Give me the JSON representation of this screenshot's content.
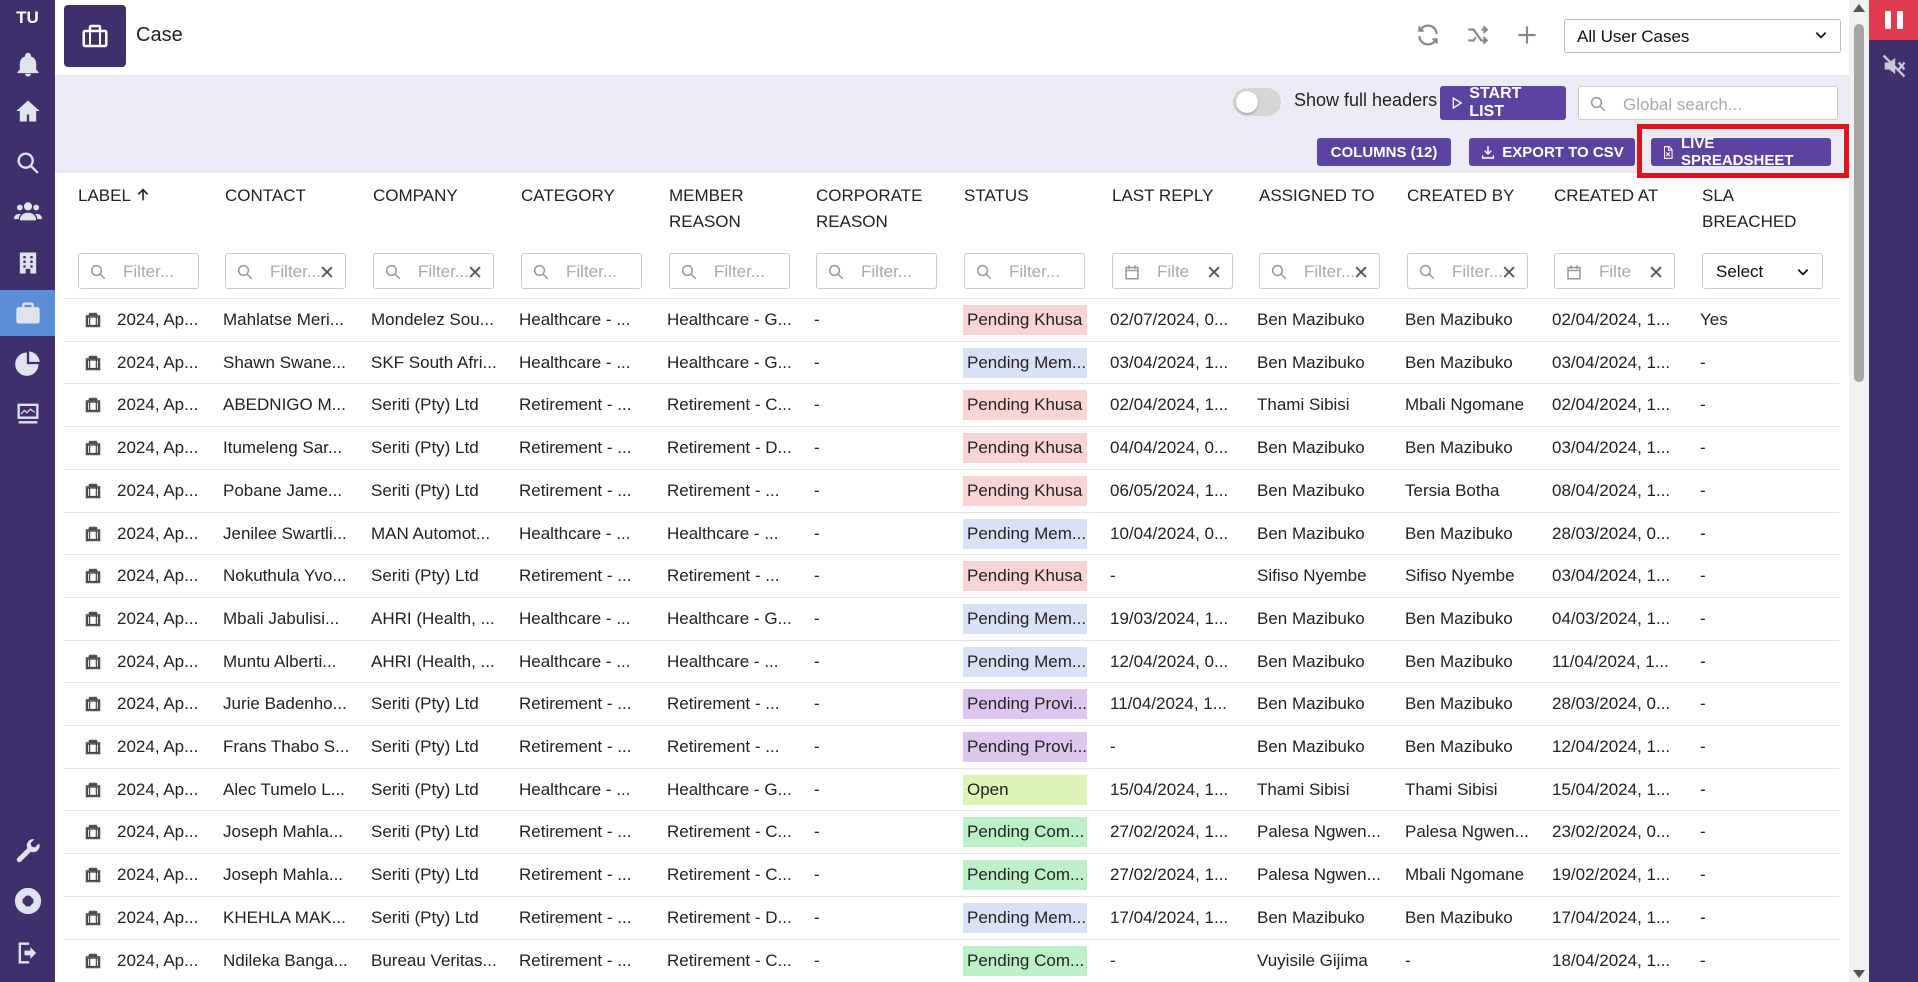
{
  "sidebar": {
    "brand": "TU",
    "items": [
      {
        "icon": "bell-icon"
      },
      {
        "icon": "home-icon"
      },
      {
        "icon": "search-icon"
      },
      {
        "icon": "users-icon"
      },
      {
        "icon": "building-icon"
      },
      {
        "icon": "briefcase-icon",
        "active": true
      },
      {
        "icon": "pie-chart-icon"
      },
      {
        "icon": "monitor-icon"
      },
      {
        "icon": "wrench-icon"
      },
      {
        "icon": "help-icon"
      },
      {
        "icon": "logout-icon"
      }
    ]
  },
  "header": {
    "title": "Case",
    "view_select": "All User Cases"
  },
  "toolbar": {
    "toggle_label": "Show full headers",
    "start_list": "START LIST",
    "global_search_placeholder": "Global search...",
    "columns_button": "COLUMNS (12)",
    "export_button": "EXPORT TO CSV",
    "live_button": "LIVE SPREADSHEET"
  },
  "table": {
    "headers": {
      "label": "LABEL",
      "contact": "CONTACT",
      "company": "COMPANY",
      "category": "CATEGORY",
      "member_reason_1": "MEMBER",
      "member_reason_2": "REASON",
      "corporate_reason_1": "CORPORATE",
      "corporate_reason_2": "REASON",
      "status": "STATUS",
      "last_reply": "LAST REPLY",
      "assigned_to": "ASSIGNED TO",
      "created_by": "CREATED BY",
      "created_at": "CREATED AT",
      "sla_1": "SLA",
      "sla_2": "BREACHED"
    },
    "filters": {
      "placeholder": "Filter...",
      "date_placeholder": "Filte",
      "select_label": "Select"
    },
    "rows": [
      {
        "label": "2024, Ap...",
        "contact": "Mahlatse Meri...",
        "company": "Mondelez Sou...",
        "category": "Healthcare - ...",
        "member_reason": "Healthcare - G...",
        "corporate_reason": "-",
        "status": "Pending Khusa",
        "status_color": "#f8d4d4",
        "last_reply": "02/07/2024, 0...",
        "assigned_to": "Ben Mazibuko",
        "created_by": "Ben Mazibuko",
        "created_at": "02/04/2024, 1...",
        "sla": "Yes"
      },
      {
        "label": "2024, Ap...",
        "contact": "Shawn Swane...",
        "company": "SKF South Afri...",
        "category": "Healthcare - ...",
        "member_reason": "Healthcare - G...",
        "corporate_reason": "-",
        "status": "Pending Mem...",
        "status_color": "#d9e1f6",
        "last_reply": "03/04/2024, 1...",
        "assigned_to": "Ben Mazibuko",
        "created_by": "Ben Mazibuko",
        "created_at": "03/04/2024, 1...",
        "sla": "-"
      },
      {
        "label": "2024, Ap...",
        "contact": "ABEDNIGO M...",
        "company": "Seriti (Pty) Ltd",
        "category": "Retirement - ...",
        "member_reason": "Retirement - C...",
        "corporate_reason": "-",
        "status": "Pending Khusa",
        "status_color": "#f8d4d4",
        "last_reply": "02/04/2024, 1...",
        "assigned_to": "Thami Sibisi",
        "created_by": "Mbali Ngomane",
        "created_at": "02/04/2024, 1...",
        "sla": "-"
      },
      {
        "label": "2024, Ap...",
        "contact": "Itumeleng Sar...",
        "company": "Seriti (Pty) Ltd",
        "category": "Retirement - ...",
        "member_reason": "Retirement - D...",
        "corporate_reason": "-",
        "status": "Pending Khusa",
        "status_color": "#f8d4d4",
        "last_reply": "04/04/2024, 0...",
        "assigned_to": "Ben Mazibuko",
        "created_by": "Ben Mazibuko",
        "created_at": "03/04/2024, 1...",
        "sla": "-"
      },
      {
        "label": "2024, Ap...",
        "contact": "Pobane Jame...",
        "company": "Seriti (Pty) Ltd",
        "category": "Retirement - ...",
        "member_reason": "Retirement - ...",
        "corporate_reason": "-",
        "status": "Pending Khusa",
        "status_color": "#f8d4d4",
        "last_reply": "06/05/2024, 1...",
        "assigned_to": "Ben Mazibuko",
        "created_by": "Tersia Botha",
        "created_at": "08/04/2024, 1...",
        "sla": "-"
      },
      {
        "label": "2024, Ap...",
        "contact": "Jenilee Swartli...",
        "company": "MAN Automot...",
        "category": "Healthcare - ...",
        "member_reason": "Healthcare - ...",
        "corporate_reason": "-",
        "status": "Pending Mem...",
        "status_color": "#d9e1f6",
        "last_reply": "10/04/2024, 0...",
        "assigned_to": "Ben Mazibuko",
        "created_by": "Ben Mazibuko",
        "created_at": "28/03/2024, 0...",
        "sla": "-"
      },
      {
        "label": "2024, Ap...",
        "contact": "Nokuthula Yvo...",
        "company": "Seriti (Pty) Ltd",
        "category": "Retirement - ...",
        "member_reason": "Retirement - ...",
        "corporate_reason": "-",
        "status": "Pending Khusa",
        "status_color": "#f8d4d4",
        "last_reply": "-",
        "assigned_to": "Sifiso Nyembe",
        "created_by": "Sifiso Nyembe",
        "created_at": "03/04/2024, 1...",
        "sla": "-"
      },
      {
        "label": "2024, Ap...",
        "contact": "Mbali Jabulisi...",
        "company": "AHRI (Health, ...",
        "category": "Healthcare - ...",
        "member_reason": "Healthcare - G...",
        "corporate_reason": "-",
        "status": "Pending Mem...",
        "status_color": "#d9e1f6",
        "last_reply": "19/03/2024, 1...",
        "assigned_to": "Ben Mazibuko",
        "created_by": "Ben Mazibuko",
        "created_at": "04/03/2024, 1...",
        "sla": "-"
      },
      {
        "label": "2024, Ap...",
        "contact": "Muntu Alberti...",
        "company": "AHRI (Health, ...",
        "category": "Healthcare - ...",
        "member_reason": "Healthcare - ...",
        "corporate_reason": "-",
        "status": "Pending Mem...",
        "status_color": "#d9e1f6",
        "last_reply": "12/04/2024, 0...",
        "assigned_to": "Ben Mazibuko",
        "created_by": "Ben Mazibuko",
        "created_at": "11/04/2024, 1...",
        "sla": "-"
      },
      {
        "label": "2024, Ap...",
        "contact": "Jurie Badenho...",
        "company": "Seriti (Pty) Ltd",
        "category": "Retirement - ...",
        "member_reason": "Retirement - ...",
        "corporate_reason": "-",
        "status": "Pending Provi...",
        "status_color": "#dcc6ee",
        "last_reply": "11/04/2024, 1...",
        "assigned_to": "Ben Mazibuko",
        "created_by": "Ben Mazibuko",
        "created_at": "28/03/2024, 0...",
        "sla": "-"
      },
      {
        "label": "2024, Ap...",
        "contact": "Frans Thabo S...",
        "company": "Seriti (Pty) Ltd",
        "category": "Retirement - ...",
        "member_reason": "Retirement - ...",
        "corporate_reason": "-",
        "status": "Pending Provi...",
        "status_color": "#dcc6ee",
        "last_reply": "-",
        "assigned_to": "Ben Mazibuko",
        "created_by": "Ben Mazibuko",
        "created_at": "12/04/2024, 1...",
        "sla": "-"
      },
      {
        "label": "2024, Ap...",
        "contact": "Alec Tumelo L...",
        "company": "Seriti (Pty) Ltd",
        "category": "Healthcare - ...",
        "member_reason": "Healthcare - G...",
        "corporate_reason": "-",
        "status": "Open",
        "status_color": "#ddf6b8",
        "last_reply": "15/04/2024, 1...",
        "assigned_to": "Thami Sibisi",
        "created_by": "Thami Sibisi",
        "created_at": "15/04/2024, 1...",
        "sla": "-"
      },
      {
        "label": "2024, Ap...",
        "contact": "Joseph Mahla...",
        "company": "Seriti (Pty) Ltd",
        "category": "Retirement - ...",
        "member_reason": "Retirement - C...",
        "corporate_reason": "-",
        "status": "Pending Com...",
        "status_color": "#bdf0c8",
        "last_reply": "27/02/2024, 1...",
        "assigned_to": "Palesa Ngwen...",
        "created_by": "Palesa Ngwen...",
        "created_at": "23/02/2024, 0...",
        "sla": "-"
      },
      {
        "label": "2024, Ap...",
        "contact": "Joseph Mahla...",
        "company": "Seriti (Pty) Ltd",
        "category": "Retirement - ...",
        "member_reason": "Retirement - C...",
        "corporate_reason": "-",
        "status": "Pending Com...",
        "status_color": "#bdf0c8",
        "last_reply": "27/02/2024, 1...",
        "assigned_to": "Palesa Ngwen...",
        "created_by": "Mbali Ngomane",
        "created_at": "19/02/2024, 1...",
        "sla": "-"
      },
      {
        "label": "2024, Ap...",
        "contact": "KHEHLA MAK...",
        "company": "Seriti (Pty) Ltd",
        "category": "Retirement - ...",
        "member_reason": "Retirement - D...",
        "corporate_reason": "-",
        "status": "Pending Mem...",
        "status_color": "#d9e1f6",
        "last_reply": "17/04/2024, 1...",
        "assigned_to": "Ben Mazibuko",
        "created_by": "Ben Mazibuko",
        "created_at": "17/04/2024, 1...",
        "sla": "-"
      },
      {
        "label": "2024, Ap...",
        "contact": "Ndileka Banga...",
        "company": "Bureau Veritas...",
        "category": "Retirement - ...",
        "member_reason": "Retirement - C...",
        "corporate_reason": "-",
        "status": "Pending Com...",
        "status_color": "#bdf0c8",
        "last_reply": "-",
        "assigned_to": "Vuyisile Gijima",
        "created_by": "-",
        "created_at": "18/04/2024, 1...",
        "sla": "-"
      }
    ]
  }
}
